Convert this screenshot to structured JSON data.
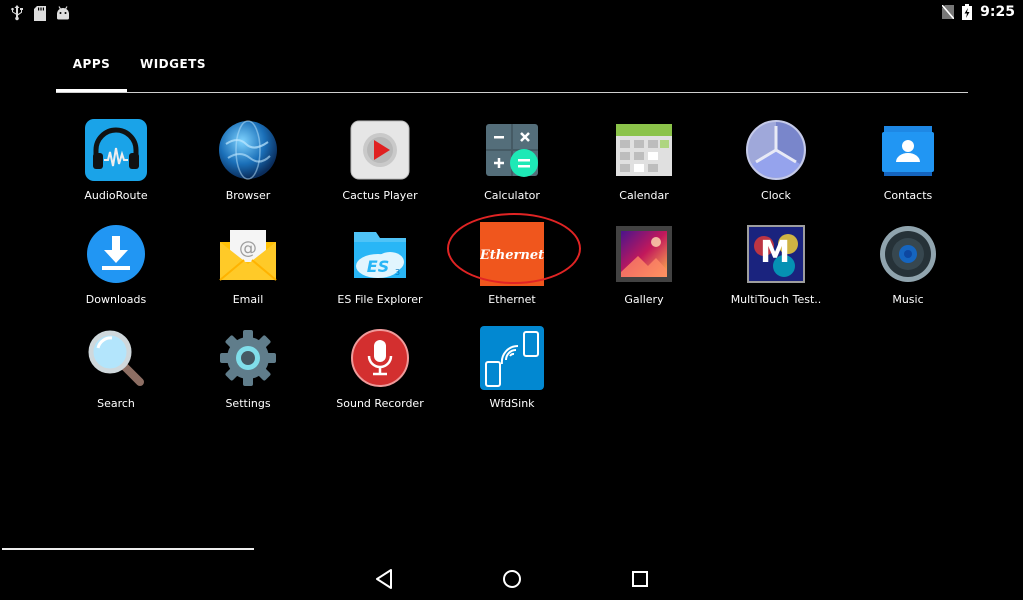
{
  "status_bar": {
    "left_icons": [
      "usb-icon",
      "sd-card-icon",
      "android-debug-icon"
    ],
    "right_icons": [
      "no-sim-icon",
      "battery-charging-icon"
    ],
    "time": "9:25"
  },
  "tabs": [
    {
      "label": "APPS",
      "selected": true
    },
    {
      "label": "WIDGETS",
      "selected": false
    }
  ],
  "apps": [
    {
      "label": "AudioRoute",
      "icon": "audioroute-icon"
    },
    {
      "label": "Browser",
      "icon": "browser-icon"
    },
    {
      "label": "Cactus Player",
      "icon": "cactus-player-icon"
    },
    {
      "label": "Calculator",
      "icon": "calculator-icon"
    },
    {
      "label": "Calendar",
      "icon": "calendar-icon"
    },
    {
      "label": "Clock",
      "icon": "clock-icon"
    },
    {
      "label": "Contacts",
      "icon": "contacts-icon"
    },
    {
      "label": "Downloads",
      "icon": "downloads-icon"
    },
    {
      "label": "Email",
      "icon": "email-icon"
    },
    {
      "label": "ES File Explorer",
      "icon": "es-file-explorer-icon"
    },
    {
      "label": "Ethernet",
      "icon": "ethernet-icon",
      "icon_text": "Ethernet"
    },
    {
      "label": "Gallery",
      "icon": "gallery-icon"
    },
    {
      "label": "MultiTouch Test..",
      "icon": "multitouch-test-icon"
    },
    {
      "label": "Music",
      "icon": "music-icon"
    },
    {
      "label": "Search",
      "icon": "search-icon"
    },
    {
      "label": "Settings",
      "icon": "settings-icon"
    },
    {
      "label": "Sound Recorder",
      "icon": "sound-recorder-icon"
    },
    {
      "label": "WfdSink",
      "icon": "wfdsink-icon"
    }
  ],
  "nav_bar": {
    "buttons": [
      "back-icon",
      "home-icon",
      "recents-icon"
    ]
  },
  "colors": {
    "background": "#000000",
    "highlight_ring": "#e02424",
    "ethernet_orange": "#f0561d",
    "audioroute_blue": "#1aa3e8",
    "downloads_blue": "#2196f3"
  }
}
